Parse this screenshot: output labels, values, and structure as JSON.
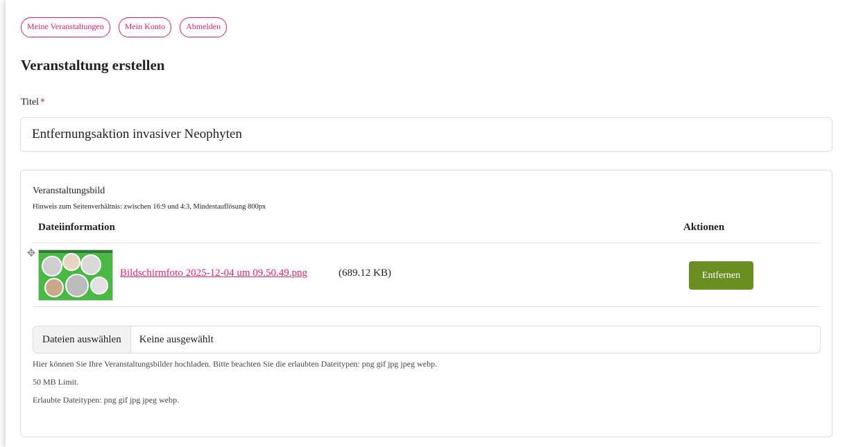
{
  "nav": {
    "items": [
      "Meine Veranstaltungen",
      "Mein Konto",
      "Abmelden"
    ]
  },
  "page": {
    "title": "Veranstaltung erstellen"
  },
  "form": {
    "title_label": "Titel",
    "required_mark": "*",
    "title_value": "Entfernungsaktion invasiver Neophyten",
    "image": {
      "legend": "Veranstaltungsbild",
      "hint": "Hinweis zum Seitenverhältnis: zwischen 16:9 und 4:3, Mindestauflösung 800px",
      "columns": {
        "info": "Dateiinformation",
        "actions": "Aktionen"
      },
      "files": [
        {
          "name": "Bildschirmfoto 2025-12-04 um 09.50.49.png",
          "size": "(689.12 KB)",
          "action": "Entfernen",
          "thumbnail_icon": "image-thumbnail"
        }
      ],
      "picker": {
        "button": "Dateien auswählen",
        "status": "Keine ausgewählt"
      },
      "help": [
        "Hier können Sie Ihre Veranstaltungsbilder hochladen. Bitte beachten Sie die erlaubten Dateitypen: png gif jpg jpeg webp.",
        "50 MB Limit.",
        "Erlaubte Dateitypen: png gif jpg jpeg webp."
      ]
    }
  },
  "colors": {
    "accent": "#d6246e",
    "button_green": "#6b8e23",
    "thumbnail_green": "#49b845"
  }
}
